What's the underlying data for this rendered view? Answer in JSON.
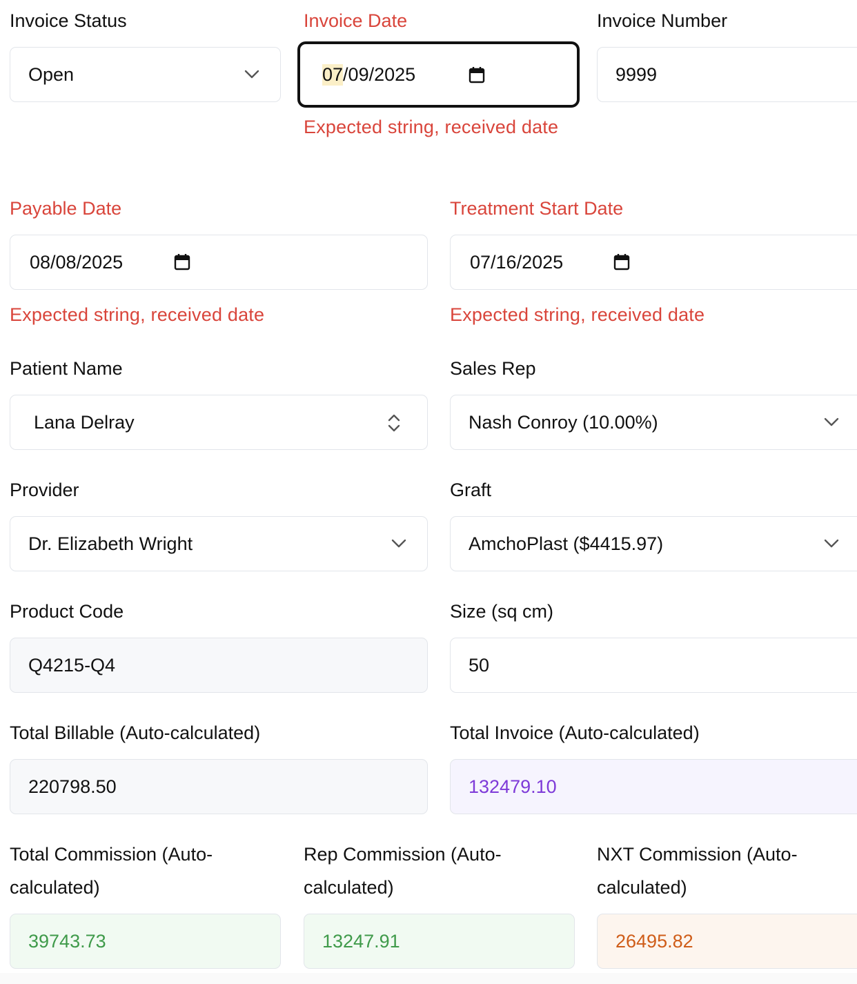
{
  "invoice_status": {
    "label": "Invoice Status",
    "value": "Open"
  },
  "invoice_date": {
    "label": "Invoice Date",
    "month": "07",
    "rest": "/09/2025",
    "error": "Expected string, received date"
  },
  "invoice_number": {
    "label": "Invoice Number",
    "value": "9999"
  },
  "payable_date": {
    "label": "Payable Date",
    "value": "08/08/2025",
    "error": "Expected string, received date"
  },
  "treatment_start_date": {
    "label": "Treatment Start Date",
    "value": "07/16/2025",
    "error": "Expected string, received date"
  },
  "patient_name": {
    "label": "Patient Name",
    "value": "Lana Delray"
  },
  "sales_rep": {
    "label": "Sales Rep",
    "value": "Nash Conroy (10.00%)"
  },
  "provider": {
    "label": "Provider",
    "value": "Dr. Elizabeth Wright"
  },
  "graft": {
    "label": "Graft",
    "value": "AmchoPlast ($4415.97)"
  },
  "product_code": {
    "label": "Product Code",
    "value": "Q4215-Q4"
  },
  "size": {
    "label": "Size (sq cm)",
    "value": "50"
  },
  "total_billable": {
    "label": "Total Billable (Auto-calculated)",
    "value": "220798.50"
  },
  "total_invoice": {
    "label": "Total Invoice (Auto-calculated)",
    "value": "132479.10"
  },
  "total_commission": {
    "label": "Total Commission (Auto-calculated)",
    "value": "39743.73"
  },
  "rep_commission": {
    "label": "Rep Commission (Auto-calculated)",
    "value": "13247.91"
  },
  "nxt_commission": {
    "label": "NXT Commission (Auto-calculated)",
    "value": "26495.82"
  },
  "colors": {
    "error": "#d9453b",
    "purple_text": "#7e3ad8",
    "green_text": "#3f9a4a",
    "orange_text": "#cf5d19",
    "border": "#e2e5ea"
  },
  "icons": [
    "chevron-down-icon",
    "calendar-icon",
    "chevron-up-down-icon"
  ]
}
